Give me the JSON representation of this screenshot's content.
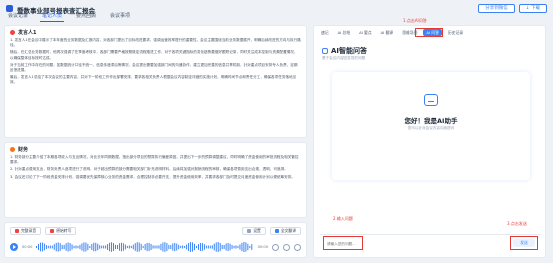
{
  "app": {
    "title": "暨数事业部号报表查汇报会",
    "buttons": {
      "share": "分享到微信",
      "download": "↓ 下载"
    }
  },
  "tabs": [
    "会议记录",
    "笔记人员",
    "要点回顾",
    "会议事项"
  ],
  "transcript": {
    "section1": {
      "title": "发言人1",
      "paragraphs": [
        "1. 发言人1在会议中展示了本年度的业务数据及汇报内容，对各部门提出了目标改进要求，强调运营效率提升的重要性，会议主要围绕当前业务数据展开，明确后续改进的方向与执行路径。",
        "随后，在汇总业务数据时，他再次强调了在季度考核中，各部门需要严格按照既定流程推进工作，对于各项关键指标的变化趋势要做好跟踪记录，同时关注成本控制与资源配置情况，以确保整体目标按时达成。",
        "对于当前工作中存在的问题，如数据统计口径不统一、信息传递滞后等情况，会议提出需要加强部门间的沟通协作，建立更加完善的信息共享机制，针对重点项目安排专人负责，定期反馈进展。",
        "最后，发言人1总结了本次会议的主要内容，并对下一阶段工作作出部署安排，要求各相关负责人根据会议内容制定详细的实施计划，明确时间节点和责任分工，确保各项任务落地见效。"
      ]
    },
    "section2": {
      "title": "财务",
      "paragraphs": [
        "1. 财务部分主要介绍了本期各项收入与支出情况，对比去年同期数据，指出部分项目的预算执行偏差原因，并提出下一步的预算调整建议，同时明确了资金使用的审批流程及相关管控要求。",
        "2. 针对重点费用支出，财务负责人逐项进行了说明，对于超出预算的部分需要相关部门补充说明材料，后续将加强对报销流程的审核，确保各项费用支出合规、透明、可追溯。",
        "3. 会议还讨论了下一阶段资金安排计划，强调要优先保障核心业务的资金需求，合理控制非必要开支，提升资金使用效率，并要求各部门及时提交月度资金使用计划以便统筹安排。"
      ]
    },
    "player": {
      "buttons": [
        "完整录音",
        "原始转写",
        "设置",
        "全文翻译"
      ],
      "current_time": "00:00",
      "total_time": "00:00"
    }
  },
  "assistant": {
    "tabs": [
      "速记",
      "AI 总结",
      "AI 要点",
      "AI 翻译",
      "思维导图",
      "AI 问答",
      "历史记录"
    ],
    "active_tab": "AI 问答",
    "title": "AI智能问答",
    "subtitle": "基于会议内容回答您的问题",
    "welcome_title": "您好！我是AI助手",
    "welcome_sub": "您可以针对会议内容向我提问",
    "input_placeholder": "请输入您的问题...",
    "send_label": "发送",
    "annotations": [
      "1.点击AI问答",
      "2.输入问题",
      "3.点击发送"
    ]
  }
}
